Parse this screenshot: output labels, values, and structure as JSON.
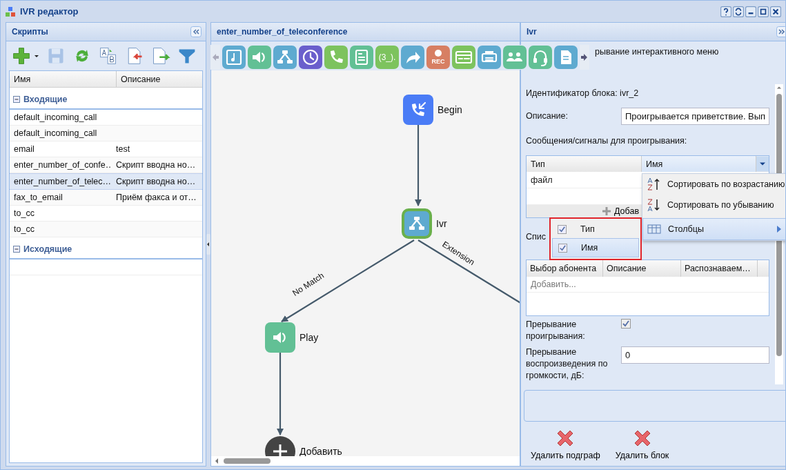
{
  "window": {
    "title": "IVR редактор"
  },
  "scripts_panel": {
    "title": "Скрипты",
    "columns": [
      "Имя",
      "Описание"
    ],
    "groups": [
      {
        "name": "Входящие",
        "expanded": true,
        "rows": [
          {
            "name": "default_incoming_call",
            "selected": false
          },
          {
            "name": "default_incoming_call",
            "selected": false
          },
          {
            "name": "email",
            "description": "test",
            "selected": false
          },
          {
            "name": "enter_number_of_confe…",
            "description": "Скрипт вводна но…",
            "selected": false
          },
          {
            "name": "enter_number_of_telec…",
            "description": "Скрипт вводна но…",
            "selected": true
          },
          {
            "name": "fax_to_email",
            "description": "Приём факса и от…",
            "selected": false
          },
          {
            "name": "to_cc",
            "selected": false
          },
          {
            "name": "to_cc",
            "selected": false
          }
        ]
      },
      {
        "name": "Исходящие",
        "expanded": true
      }
    ]
  },
  "canvas": {
    "title": "enter_number_of_teleconference",
    "palette": [
      {
        "kind": "music",
        "color": "#5eaad0"
      },
      {
        "kind": "speaker",
        "color": "#62c095"
      },
      {
        "kind": "tree",
        "color": "#5eaad0"
      },
      {
        "kind": "clock",
        "color": "#6a5fcc"
      },
      {
        "kind": "phone",
        "color": "#7dc35e"
      },
      {
        "kind": "card",
        "color": "#62c095"
      },
      {
        "kind": "text",
        "color": "#7dc35e",
        "text": "(3_)."
      },
      {
        "kind": "forward",
        "color": "#5eaad0"
      },
      {
        "kind": "rec",
        "color": "#d77f63",
        "text": "REC"
      },
      {
        "kind": "idcard",
        "color": "#7dc35e"
      },
      {
        "kind": "fax",
        "color": "#5eaad0"
      },
      {
        "kind": "group",
        "color": "#62c095"
      },
      {
        "kind": "headset",
        "color": "#62c095"
      },
      {
        "kind": "doc",
        "color": "#5eaad0"
      }
    ],
    "nodes": [
      {
        "kind": "begin",
        "label": "Begin",
        "selected": false
      },
      {
        "kind": "tree",
        "label": "Ivr",
        "selected": true
      },
      {
        "kind": "speaker",
        "label": "Play",
        "selected": false
      },
      {
        "kind": "add",
        "label": "Добавить",
        "selected": false
      }
    ],
    "edges": [
      {
        "label": "No Match"
      },
      {
        "label": "Extension"
      }
    ]
  },
  "properties": {
    "title": "Ivr",
    "heading_fragment": "рывание интерактивного меню",
    "block_id": "Идентификатор блока: ivr_2",
    "description_label": "Описание:",
    "description_value": "Проигрывается приветствие. Вып",
    "messages_label": "Сообщения/сигналы для проигрывания:",
    "messages_grid": {
      "columns": [
        "Тип",
        "Имя"
      ],
      "rows": [
        "файл"
      ],
      "add_button": "Добав"
    },
    "list_label_fragment": "Спис",
    "subscribers_grid": {
      "columns": [
        "Выбор абонента",
        "Описание",
        "Распознаваем…"
      ],
      "add_row": "Добавить..."
    },
    "interrupt_label": "Прерывание проигрывания:",
    "interrupt_checked": true,
    "volume_label": "Прерывание воспроизведения по громкости, дБ:",
    "volume_value": "0",
    "actions": [
      "Удалить подграф",
      "Удалить блок"
    ]
  },
  "column_menu": {
    "items": [
      {
        "kind": "sort-asc",
        "label": "Сортировать по возрастанию",
        "selected": false
      },
      {
        "kind": "sort-desc",
        "label": "Сортировать по убыванию",
        "selected": false
      },
      {
        "kind": "columns",
        "label": "Столбцы",
        "selected": true
      }
    ]
  },
  "columns_submenu": {
    "items": [
      {
        "label": "Тип",
        "checked": true,
        "selected": false
      },
      {
        "label": "Имя",
        "checked": true,
        "selected": true
      }
    ]
  }
}
